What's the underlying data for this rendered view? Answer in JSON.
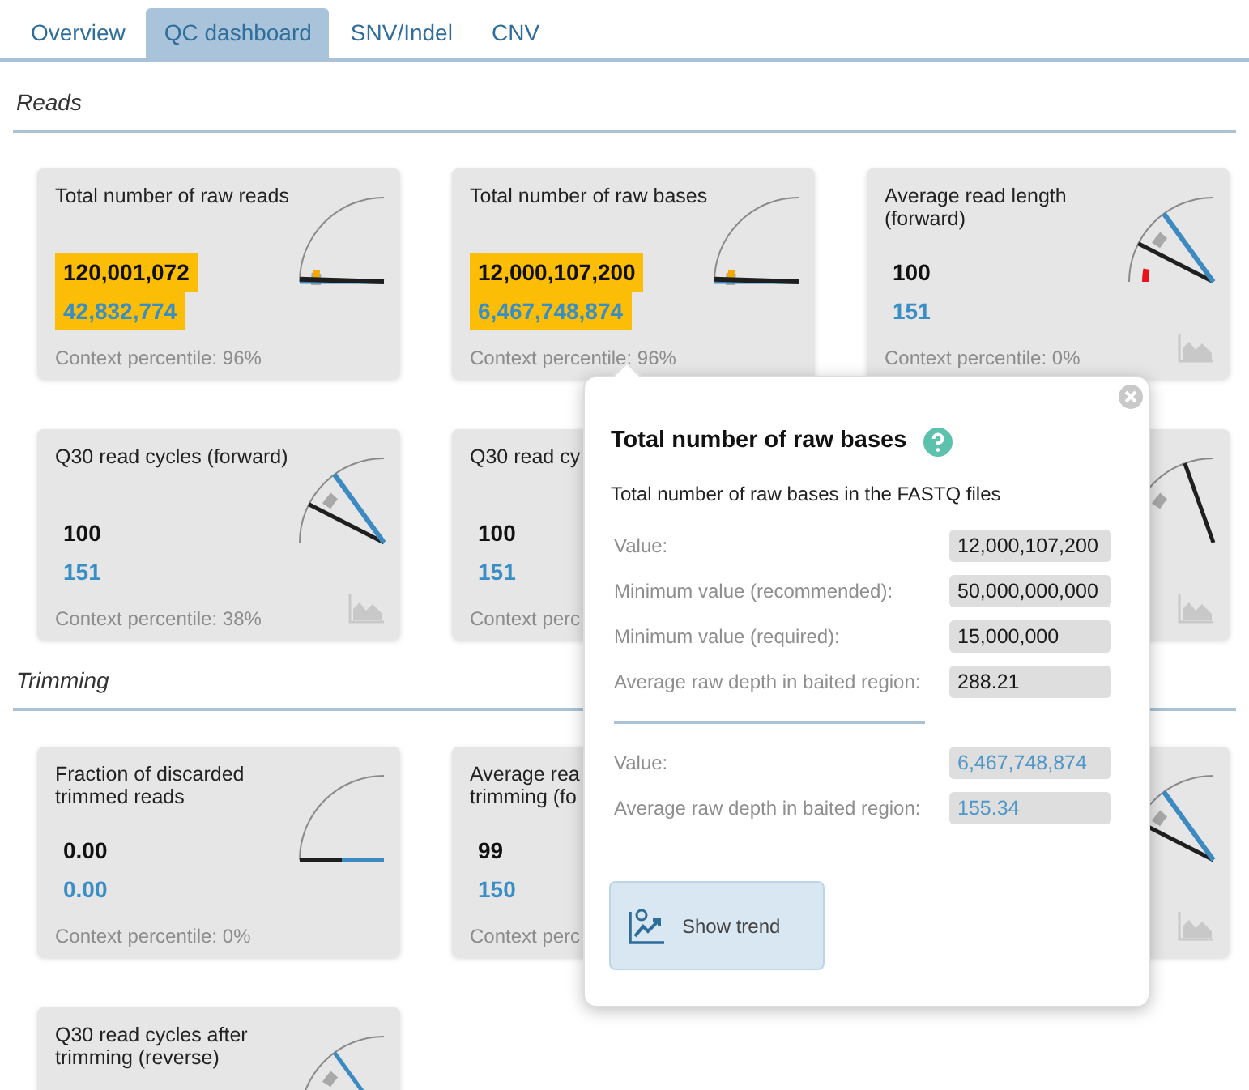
{
  "tabs": [
    {
      "label": "Overview",
      "selected": false
    },
    {
      "label": "QC dashboard",
      "selected": true
    },
    {
      "label": "SNV/Indel",
      "selected": false
    },
    {
      "label": "CNV",
      "selected": false
    }
  ],
  "sections": [
    {
      "title": "Reads",
      "cards": [
        {
          "title": "Total number of raw reads",
          "value": "120,001,072",
          "value_2": "42,832,774",
          "highlighted": true,
          "context": "Context percentile: 96%",
          "gauge": {
            "kind": "low"
          }
        },
        {
          "title": "Total number of raw bases",
          "value": "12,000,107,200",
          "value_2": "6,467,748,874",
          "highlighted": true,
          "context": "Context percentile: 96%",
          "gauge": {
            "kind": "low"
          }
        },
        {
          "title": "Average read length (forward)",
          "value": "100",
          "value_2": "151",
          "highlighted": false,
          "context": "Context percentile: 0%",
          "trend_icon": true,
          "gauge": {
            "kind": "alert"
          }
        },
        {
          "title": "Q30 read cycles (forward)",
          "value": "100",
          "value_2": "151",
          "highlighted": false,
          "context": "Context percentile: 38%",
          "trend_icon": true,
          "gauge": {
            "kind": "mid"
          }
        },
        {
          "title": "Q30 read cy",
          "value": "100",
          "value_2": "151",
          "highlighted": false,
          "context": "Context perc"
        },
        {
          "trend_icon": true,
          "gauge": {
            "kind": "high"
          }
        }
      ]
    },
    {
      "title": "Trimming",
      "cards": [
        {
          "title": "Fraction of discarded trimmed reads",
          "value": "0.00",
          "value_2": "0.00",
          "highlighted": false,
          "context": "Context percentile: 0%",
          "gauge": {
            "kind": "zero"
          }
        },
        {
          "title": "Average rea\ntrimming (fo",
          "value": "99",
          "value_2": "150",
          "highlighted": false,
          "context": "Context perc"
        },
        {
          "trend_icon": true,
          "gauge": {
            "kind": "mid"
          }
        },
        {
          "title": "Q30 read cycles after trimming (reverse)",
          "gauge": {
            "kind": "partial"
          }
        }
      ]
    }
  ],
  "popover": {
    "title": "Total number of raw bases",
    "description": "Total number of raw bases in the FASTQ files",
    "groups": [
      [
        {
          "label": "Value:",
          "value": "12,000,107,200",
          "kind": "primary"
        },
        {
          "label": "Minimum value (recommended):",
          "value": "50,000,000,000",
          "kind": "primary"
        },
        {
          "label": "Minimum value (required):",
          "value": "15,000,000",
          "kind": "primary"
        },
        {
          "label": "Average raw depth in baited region:",
          "value": "288.21",
          "kind": "primary"
        }
      ],
      [
        {
          "label": "Value:",
          "value": "6,467,748,874",
          "kind": "secondary"
        },
        {
          "label": "Average raw depth in baited region:",
          "value": "155.34",
          "kind": "secondary"
        }
      ]
    ],
    "button": "Show trend"
  }
}
